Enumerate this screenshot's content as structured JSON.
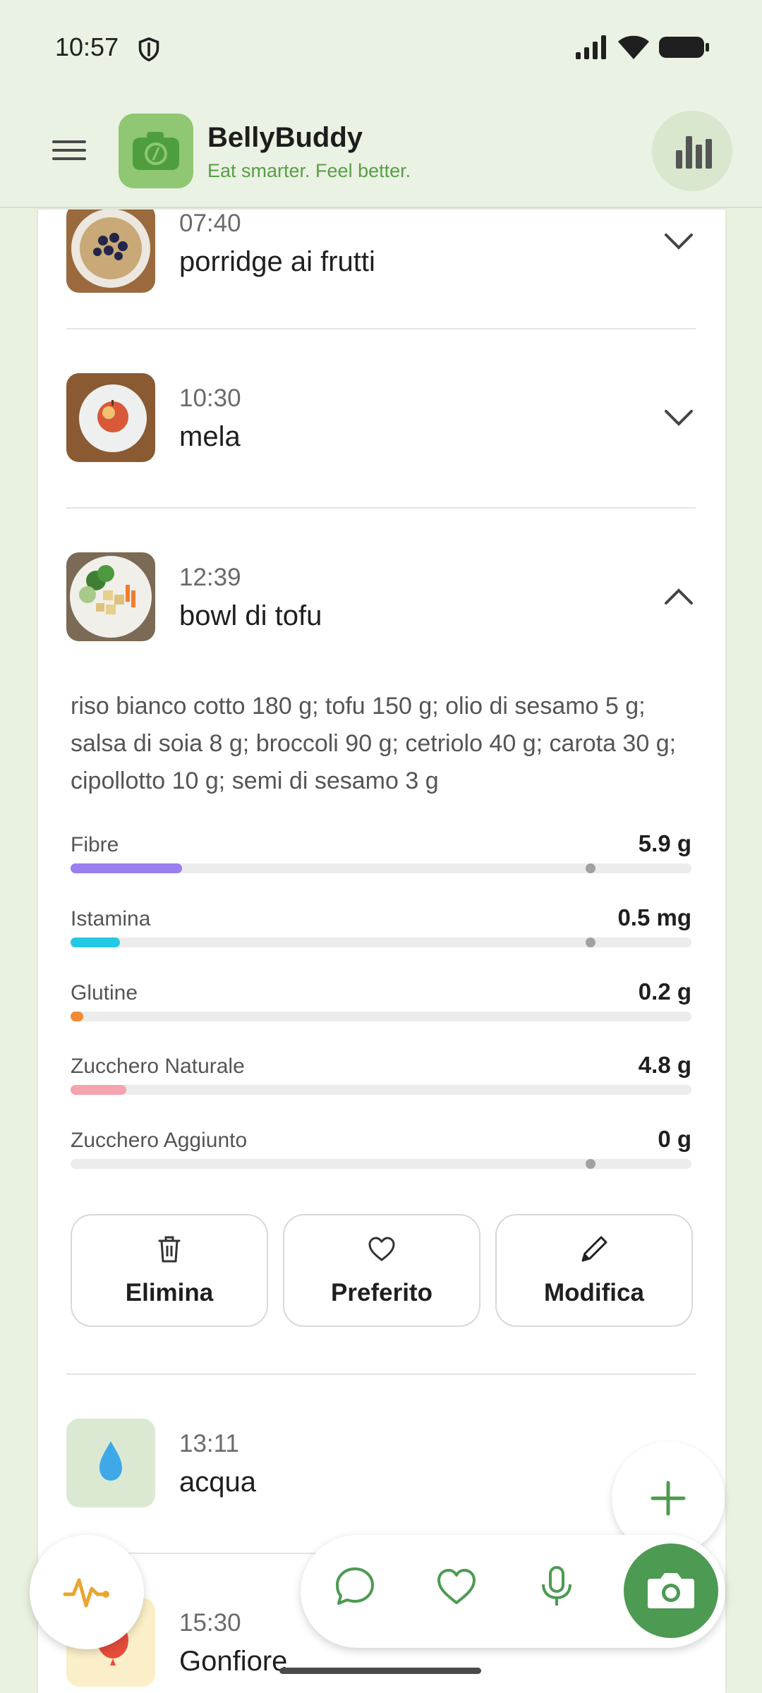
{
  "status_bar": {
    "time": "10:57"
  },
  "header": {
    "title": "BellyBuddy",
    "subtitle": "Eat smarter. Feel better."
  },
  "meals": [
    {
      "time": "07:40",
      "name": "porridge ai frutti",
      "expanded": false,
      "thumb": "oatmeal-bowl"
    },
    {
      "time": "10:30",
      "name": "mela",
      "expanded": false,
      "thumb": "apple-plate"
    },
    {
      "time": "12:39",
      "name": "bowl di tofu",
      "expanded": true,
      "thumb": "tofu-bowl"
    },
    {
      "time": "13:11",
      "name": "acqua",
      "expanded": false,
      "thumb": "water-drop-icon"
    },
    {
      "time": "15:30",
      "name": "Gonfiore",
      "expanded": false,
      "thumb": "balloon-icon"
    }
  ],
  "expanded_meal": {
    "ingredients": "riso bianco cotto 180 g; tofu 150 g; olio di sesamo 5 g; salsa di soia 8 g; broccoli 90 g; cetriolo 40 g; carota 30 g; cipollotto 10 g; semi di sesamo 3 g",
    "nutrients": [
      {
        "label": "Fibre",
        "value": "5.9 g",
        "fill": 0.18,
        "color": "#9b7ef0",
        "marker": 0.83
      },
      {
        "label": "Istamina",
        "value": "0.5 mg",
        "fill": 0.08,
        "color": "#22c9e4",
        "marker": 0.83
      },
      {
        "label": "Glutine",
        "value": "0.2 g",
        "fill": 0.02,
        "color": "#f08a35",
        "marker": null
      },
      {
        "label": "Zucchero Naturale",
        "value": "4.8 g",
        "fill": 0.09,
        "color": "#f5a3ae",
        "marker": null
      },
      {
        "label": "Zucchero Aggiunto",
        "value": "0 g",
        "fill": 0.0,
        "color": "#cccccc",
        "marker": 0.83
      }
    ],
    "actions": {
      "delete": "Elimina",
      "favorite": "Preferito",
      "edit": "Modifica"
    }
  },
  "colors": {
    "brand_green": "#4d9a52",
    "header_bg": "#eaf2e3",
    "subtitle": "#5a9d47"
  }
}
